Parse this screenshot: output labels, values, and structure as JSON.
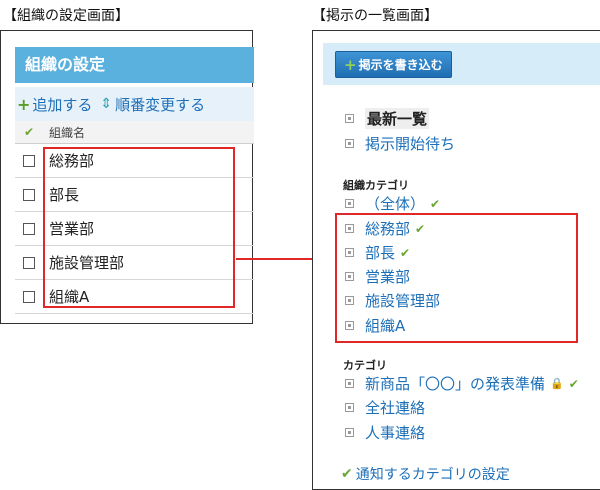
{
  "captions": {
    "left": "【組織の設定画面】",
    "right": "【掲示の一覧画面】"
  },
  "left_panel": {
    "title": "組織の設定",
    "toolbar": {
      "add_label": "追加する",
      "reorder_label": "順番変更する"
    },
    "table": {
      "column_header": "組織名",
      "rows": [
        "総務部",
        "部長",
        "営業部",
        "施設管理部",
        "組織A"
      ]
    }
  },
  "right_panel": {
    "post_button_label": "掲示を書き込む",
    "top_items": [
      "最新一覧",
      "掲示開始待ち"
    ],
    "org_category_heading": "組織カテゴリ",
    "org_all": "（全体）",
    "org_items": [
      "総務部",
      "部長",
      "営業部",
      "施設管理部",
      "組織A"
    ],
    "category_heading": "カテゴリ",
    "category_items": [
      "新商品「〇〇」の発表準備",
      "全社連絡",
      "人事連絡"
    ],
    "footer_link": "通知するカテゴリの設定"
  },
  "colors": {
    "title_bar": "#5bb1de",
    "link": "#1d6fb8",
    "highlight_box": "#e02828",
    "check": "#6aa633"
  },
  "icons": {
    "add": "plus-icon",
    "reorder": "updown-arrows-icon",
    "check": "checkmark-icon",
    "lock": "lock-icon",
    "bullet": "square-bullet-icon"
  }
}
